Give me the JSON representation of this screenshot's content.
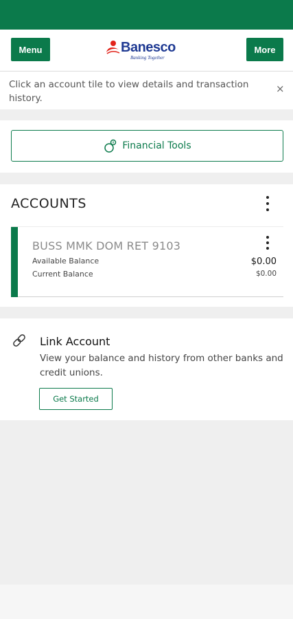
{
  "header": {
    "menu_label": "Menu",
    "more_label": "More",
    "brand_name": "Banesco",
    "brand_tagline": "Banking Together"
  },
  "banner": {
    "text": "Click an account tile to view details and transaction history.",
    "close_glyph": "×"
  },
  "tools": {
    "label": "Financial Tools",
    "icon": "piggy-bank-icon"
  },
  "accounts": {
    "title": "ACCOUNTS",
    "items": [
      {
        "name": "BUSS MMK DOM RET 9103",
        "available_label": "Available Balance",
        "available_value": "$0.00",
        "current_label": "Current Balance",
        "current_value": "$0.00"
      }
    ]
  },
  "link_account": {
    "title": "Link Account",
    "description": "View your balance and history from other banks and credit unions.",
    "button_label": "Get Started",
    "icon": "chain-link-icon"
  },
  "colors": {
    "brand_green": "#0b7a4b",
    "brand_blue": "#1f3a93",
    "brand_red": "#e2231a"
  }
}
